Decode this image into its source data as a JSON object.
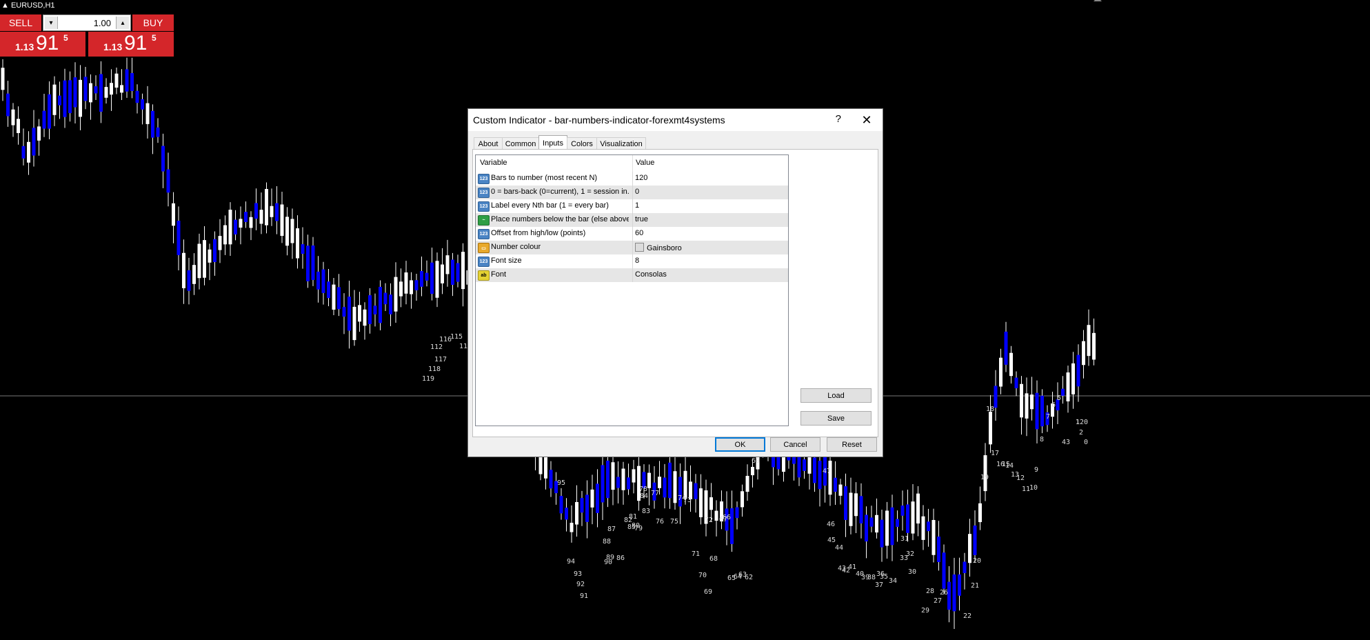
{
  "symbol": "EURUSD,H1",
  "trade_panel": {
    "sell_label": "SELL",
    "buy_label": "BUY",
    "volume": "1.00",
    "sell_price": {
      "small": "1.13",
      "big": "91",
      "sup": "5"
    },
    "buy_price": {
      "small": "1.13",
      "big": "91",
      "sup": "5"
    }
  },
  "dialog": {
    "title": "Custom Indicator - bar-numbers-indicator-forexmt4systems",
    "help": "?",
    "close": "✕",
    "tabs": [
      "About",
      "Common",
      "Inputs",
      "Colors",
      "Visualization"
    ],
    "active_tab": "Inputs",
    "columns": {
      "variable": "Variable",
      "value": "Value"
    },
    "rows": [
      {
        "icon": "123",
        "type": "num",
        "variable": "Bars to number (most recent N)",
        "value": "120"
      },
      {
        "icon": "123",
        "type": "num",
        "variable": "0 = bars-back (0=current), 1 = session in...",
        "value": "0"
      },
      {
        "icon": "123",
        "type": "num",
        "variable": "Label every Nth bar (1 = every bar)",
        "value": "1"
      },
      {
        "icon": "~",
        "type": "bool",
        "variable": "Place numbers below the bar (else above)",
        "value": "true"
      },
      {
        "icon": "123",
        "type": "num",
        "variable": "Offset from high/low (points)",
        "value": "60"
      },
      {
        "icon": "▭",
        "type": "color",
        "variable": "Number colour",
        "value": "Gainsboro"
      },
      {
        "icon": "123",
        "type": "num",
        "variable": "Font size",
        "value": "8"
      },
      {
        "icon": "ab",
        "type": "str",
        "variable": "Font",
        "value": "Consolas"
      }
    ],
    "load_label": "Load",
    "save_label": "Save",
    "ok_label": "OK",
    "cancel_label": "Cancel",
    "reset_label": "Reset"
  },
  "chart_labels": [
    "1",
    "2",
    "0",
    "43",
    "5",
    "6",
    "7",
    "8",
    "9",
    "10",
    "11",
    "12",
    "13",
    "14",
    "15",
    "16",
    "17",
    "18",
    "19",
    "20",
    "21",
    "22",
    "26",
    "27",
    "28",
    "29",
    "30",
    "31",
    "32",
    "33",
    "34",
    "35",
    "36",
    "37",
    "38",
    "39",
    "40",
    "41",
    "42",
    "43",
    "44",
    "45",
    "46",
    "47",
    "60",
    "62",
    "63",
    "64",
    "65",
    "66",
    "67",
    "68",
    "69",
    "70",
    "71",
    "72",
    "73",
    "74",
    "75",
    "76",
    "77",
    "78",
    "79",
    "80",
    "81",
    "82",
    "83",
    "84",
    "85",
    "86",
    "87",
    "88",
    "89",
    "90",
    "91",
    "92",
    "93",
    "94",
    "95",
    "112",
    "113",
    "114",
    "115",
    "116",
    "117",
    "118",
    "119",
    "120"
  ],
  "colors": {
    "bull": "#ffffff",
    "bear": "#0000ff",
    "button": "#d4262a",
    "background": "#000000",
    "label": "#dcdcdc"
  }
}
